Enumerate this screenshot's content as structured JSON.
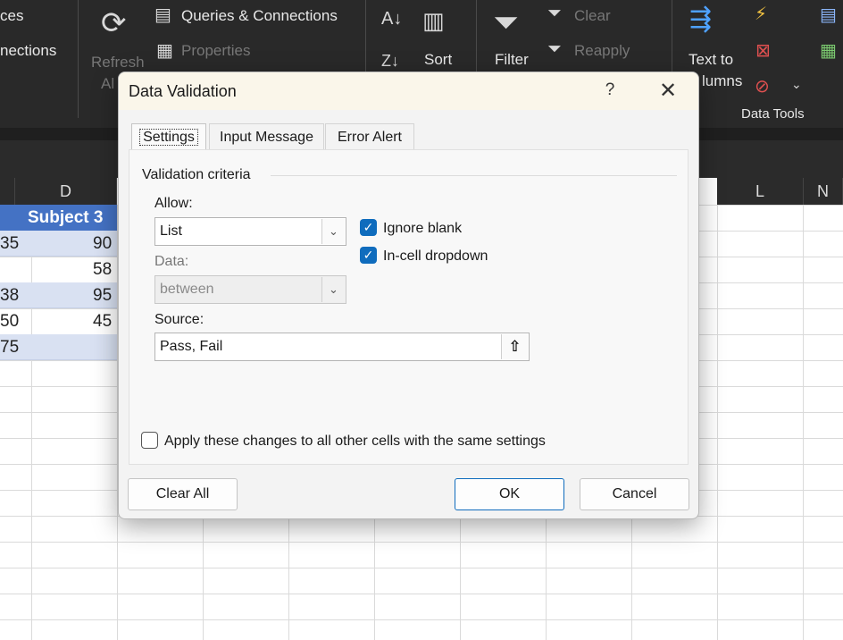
{
  "ribbon": {
    "partial_left_top": "ces",
    "partial_left_bottom": "nections",
    "refresh_label": "Refresh",
    "refresh_all_partial": "Al",
    "queries_label": "Queries & Connections",
    "properties_label": "Properties",
    "sort_label": "Sort",
    "filter_label": "Filter",
    "clear_label": "Clear",
    "reapply_label": "Reapply",
    "text_to_label": "Text to",
    "columns_partial": "lumns",
    "data_tools_label": "Data Tools"
  },
  "sheet": {
    "col_d": "D",
    "col_l": "L",
    "col_m_partial": "N",
    "header_cell": "Subject 3",
    "rows": [
      {
        "left": "35",
        "value": "90"
      },
      {
        "left": "",
        "value": "58"
      },
      {
        "left": "38",
        "value": "95"
      },
      {
        "left": "50",
        "value": "45"
      },
      {
        "left": "75",
        "value": ""
      }
    ]
  },
  "dialog": {
    "title": "Data Validation",
    "help": "?",
    "close": "✕",
    "tabs": [
      "Settings",
      "Input Message",
      "Error Alert"
    ],
    "section": "Validation criteria",
    "allow_label": "Allow:",
    "allow_value": "List",
    "data_label": "Data:",
    "data_value": "between",
    "ignore_blank_label": "Ignore blank",
    "in_cell_dropdown_label": "In-cell dropdown",
    "source_label": "Source:",
    "source_value": "Pass, Fail",
    "apply_label": "Apply these changes to all other cells with the same settings",
    "clear_all": "Clear All",
    "ok": "OK",
    "cancel": "Cancel"
  },
  "colors": {
    "accent": "#0f6cbd",
    "ribbon_bg": "#292929",
    "table_header": "#4472c4",
    "table_band": "#d9e1f2"
  }
}
